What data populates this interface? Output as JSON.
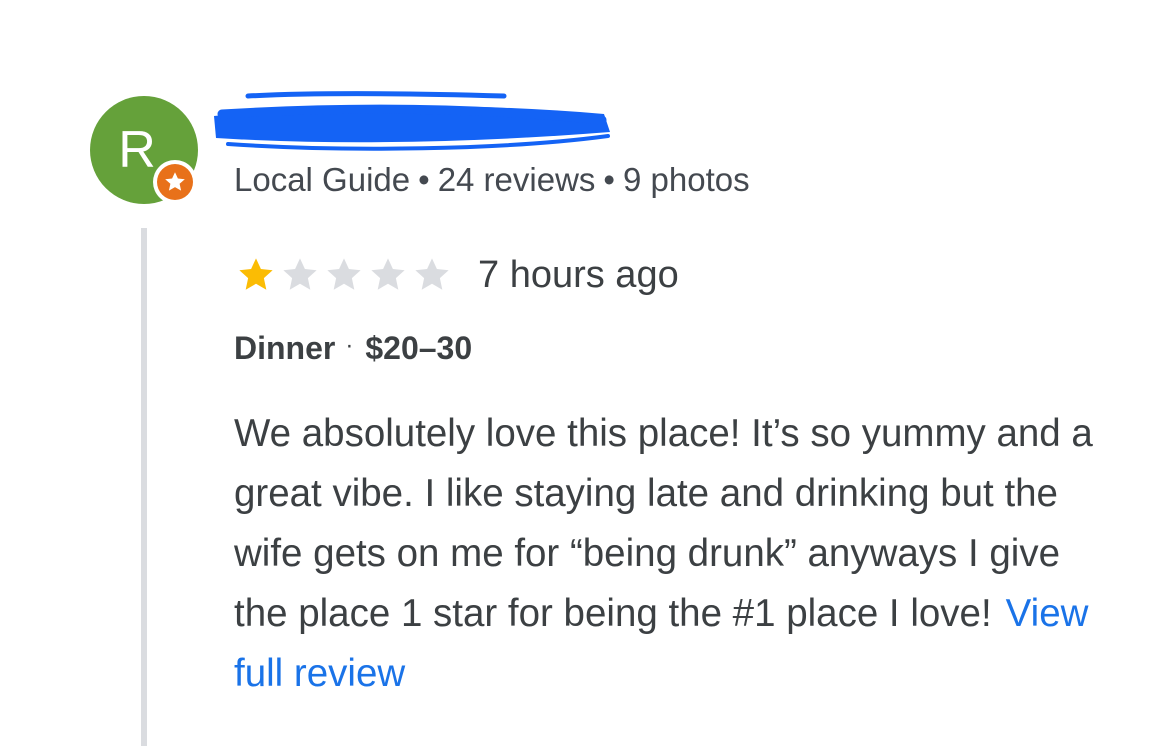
{
  "reviewer": {
    "initial": "R",
    "meta": {
      "badge": "Local Guide",
      "reviews": "24 reviews",
      "photos": "9 photos",
      "separator": "•"
    }
  },
  "review": {
    "rating": 1,
    "max_rating": 5,
    "time": "7 hours ago",
    "meal_type": "Dinner",
    "visit_separator": "·",
    "price_range": "$20–30",
    "text": "We absolutely love this place! It’s so yummy and a great vibe. I like staying late and drinking but the wife gets on me for “being drunk” anyways I give the place 1 star for being the #1 place I love!",
    "more_link": "View full review"
  },
  "colors": {
    "avatar_bg": "#65a13a",
    "guide_badge": "#e8711a",
    "star_filled": "#fbbc04",
    "star_empty": "#dadce0",
    "link": "#1a73e8",
    "redaction": "#1463f5",
    "text": "#3c4043"
  },
  "icons": {
    "guide_badge": "star-badge-icon",
    "rating": "star-icon",
    "redaction": "redaction-scribble"
  }
}
